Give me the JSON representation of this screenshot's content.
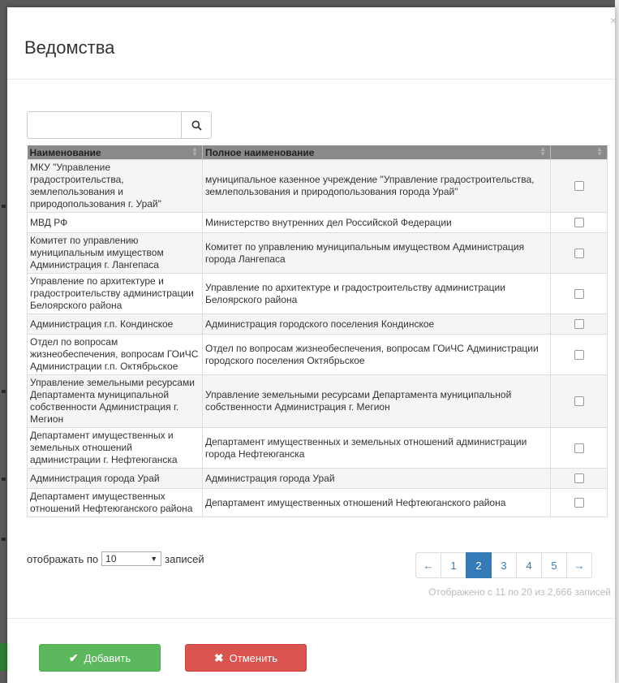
{
  "modal": {
    "title": "Ведомства",
    "close_glyph": "×"
  },
  "search": {
    "value": "",
    "placeholder": "",
    "icon": "search-icon"
  },
  "table": {
    "columns": [
      "Наименование",
      "Полное наименование",
      ""
    ],
    "rows": [
      {
        "name": "МКУ \"Управление градостроительства, землепользования и природопользования г. Урай\"",
        "full_name": "муниципальное казенное учреждение \"Управление градостроительства, землепользования и природопользования города Урай\"",
        "checked": false
      },
      {
        "name": "МВД РФ",
        "full_name": "Министерство внутренних дел Российской Федерации",
        "checked": false
      },
      {
        "name": "Комитет по управлению муниципальным имуществом Администрация г. Лангепаса",
        "full_name": "Комитет по управлению муниципальным имуществом Администрация города Лангепаса",
        "checked": false
      },
      {
        "name": "Управление по архитектуре и градостроительству администрации Белоярского района",
        "full_name": "Управление по архитектуре и градостроительству администрации Белоярского района",
        "checked": false
      },
      {
        "name": "Администрация г.п. Кондинское",
        "full_name": "Администрация городского поселения Кондинское",
        "checked": false
      },
      {
        "name": "Отдел по вопросам жизнеобеспечения, вопросам ГОиЧС Администрации г.п. Октябрьское",
        "full_name": "Отдел по вопросам жизнеобеспечения, вопросам ГОиЧС Администрации городского поселения Октябрьское",
        "checked": false
      },
      {
        "name": "Управление земельными ресурсами Департамента муниципальной собственности Администрация г. Мегион",
        "full_name": "Управление земельными ресурсами Департамента муниципальной собственности Администрация г. Мегион",
        "checked": false
      },
      {
        "name": "Департамент имущественных и земельных отношений администрации г. Нефтеюганска",
        "full_name": "Департамент имущественных и земельных отношений администрации города Нефтеюганска",
        "checked": false
      },
      {
        "name": "Администрация города Урай",
        "full_name": "Администрация города Урай",
        "checked": false
      },
      {
        "name": "Департамент имущественных отношений Нефтеюганского района",
        "full_name": "Департамент имущественных отношений Нефтеюганского района",
        "checked": false
      }
    ]
  },
  "length": {
    "prefix": "отображать по",
    "value": "10",
    "suffix": "записей"
  },
  "pagination": {
    "prev": "←",
    "pages": [
      "1",
      "2",
      "3",
      "4",
      "5"
    ],
    "active_page": "2",
    "next": "→"
  },
  "info": "Отображено с 11 по 20 из 2,666 записей",
  "buttons": {
    "add_label": "Добавить",
    "add_glyph": "✔",
    "cancel_label": "Отменить",
    "cancel_glyph": "✖"
  },
  "colors": {
    "header_bg": "#8a8a8a",
    "pager_active": "#337ab7",
    "add_button": "#5cb85c",
    "cancel_button": "#d9534f"
  }
}
